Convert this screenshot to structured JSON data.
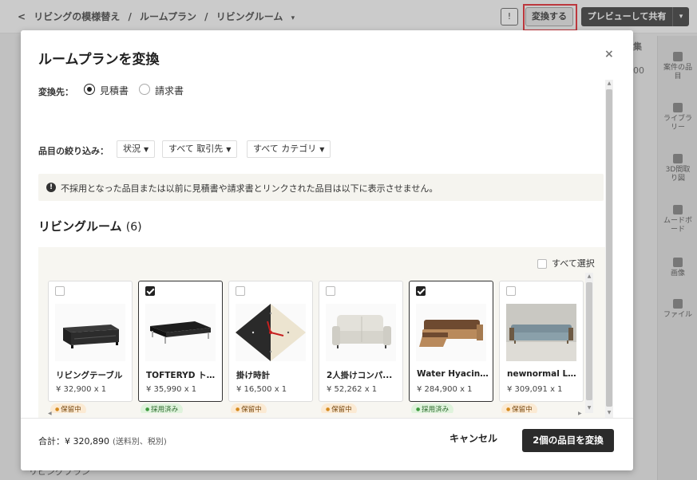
{
  "breadcrumb": {
    "back": "<",
    "items": [
      "リビングの模様替え",
      "/",
      "ルームプラン",
      "/",
      "リビングルーム"
    ],
    "caret": "▾"
  },
  "topbar": {
    "info_glyph": "!",
    "convert_label": "変換する",
    "preview_share_label": "プレビューして共有",
    "preview_caret": "▾"
  },
  "right_rail": [
    {
      "label": "案件の品\n目",
      "icon": "box-icon"
    },
    {
      "label": "ライブラ\nリー",
      "icon": "library-icon"
    },
    {
      "label": "3D間取\nり図",
      "icon": "floorplan-icon"
    },
    {
      "label": "ムードボ\nード",
      "icon": "moodboard-icon"
    },
    {
      "label": "画像",
      "icon": "image-icon"
    },
    {
      "label": "ファイル",
      "icon": "file-icon"
    }
  ],
  "background": {
    "bottom_label": "リビングプラン",
    "num1": "集",
    "num2": "00"
  },
  "modal": {
    "title": "ルームプランを変換",
    "close": "×",
    "convert_to_label": "変換先：",
    "options": [
      {
        "label": "見積書",
        "selected": true
      },
      {
        "label": "請求書",
        "selected": false
      }
    ],
    "filter_label": "品目の絞り込み：",
    "filters": [
      {
        "label": "状況"
      },
      {
        "label": "すべて 取引先"
      },
      {
        "label": "すべて カテゴリ"
      }
    ],
    "notice_icon": "!",
    "notice": "不採用となった品目または以前に見積書や請求書とリンクされた品目は以下に表示させません。",
    "section_title": "リビングルーム",
    "section_count": "(6)",
    "select_all": "すべて選択",
    "items": [
      {
        "name": "リビングテーブル",
        "price": "¥ 32,900 x 1",
        "selected": false,
        "status": "保留中",
        "status_type": "hold"
      },
      {
        "name": "TOFTERYD トフ...",
        "price": "¥ 35,990 x 1",
        "selected": true,
        "status": "採用済み",
        "status_type": "ok"
      },
      {
        "name": "掛け時計",
        "price": "¥ 16,500 x 1",
        "selected": false,
        "status": "保留中",
        "status_type": "hold"
      },
      {
        "name": "2人掛けコンパ...",
        "price": "¥ 52,262 x 1",
        "selected": false,
        "status": "保留中",
        "status_type": "hold"
      },
      {
        "name": "Water Hyacinth ...",
        "price": "¥ 284,900 x 1",
        "selected": true,
        "status": "採用済み",
        "status_type": "ok"
      },
      {
        "name": "newnormal Low...",
        "price": "¥ 309,091 x 1",
        "selected": false,
        "status": "保留中",
        "status_type": "hold"
      }
    ],
    "total_label": "合計：¥ 320,890",
    "total_note": "(送料別、税別)",
    "cancel_label": "キャンセル",
    "confirm_label": "2個の品目を変換"
  }
}
